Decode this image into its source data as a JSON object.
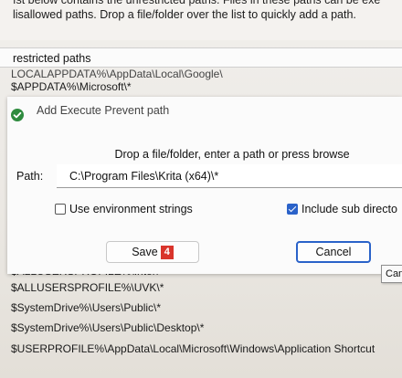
{
  "description": {
    "line1": "ıst below contains the unrestricted paths. Files in these paths can be exe",
    "line2": "lisallowed paths. Drop a file/folder over the list to quickly add a path."
  },
  "list": {
    "header": "restricted paths",
    "rows": [
      "LOCALAPPDATA%\\AppData\\Local\\Google\\",
      "$APPDATA%\\Microsoft\\*",
      "$ALLUSERSPROFILE%\\Intel\\",
      "$ALLUSERSPROFILE%\\UVK\\*",
      "$SystemDrive%\\Users\\Public\\*",
      "$SystemDrive%\\Users\\Public\\Desktop\\*",
      "$USERPROFILE%\\AppData\\Local\\Microsoft\\Windows\\Application Shortcut"
    ]
  },
  "dialog": {
    "title": "Add Execute Prevent path",
    "title_icon": "green-shield-check-icon",
    "instruction": "Drop a file/folder, enter a path or press browse",
    "path_label": "Path:",
    "path_value": "C:\\Program Files\\Krita (x64)\\*",
    "use_env_label": "Use environment strings",
    "use_env_checked": false,
    "include_sub_label": "Include sub directo",
    "include_sub_checked": true,
    "save_label": "Save",
    "save_badge": "4",
    "cancel_label": "Cancel",
    "cancel_tooltip": "Cance"
  },
  "colors": {
    "accent": "#2a62c9",
    "badge": "#d9342b",
    "shield": "#2e8b3e"
  }
}
